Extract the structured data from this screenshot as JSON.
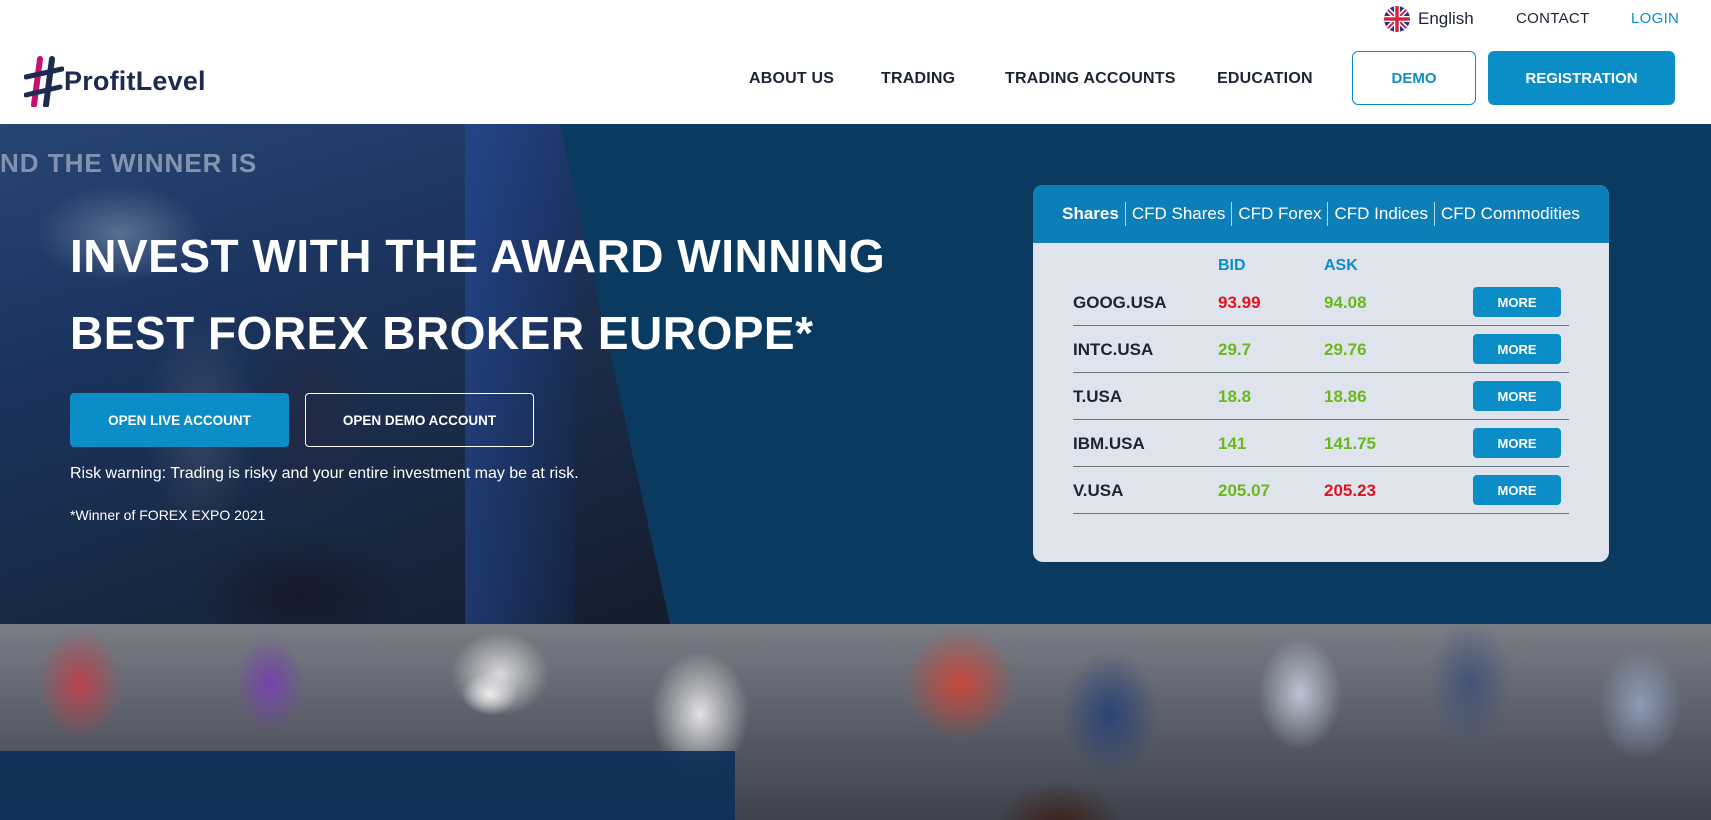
{
  "topbar": {
    "language": "English",
    "contact": "CONTACT",
    "login": "LOGIN"
  },
  "header": {
    "logo_text": "ProfitLevel",
    "nav": {
      "about": "ABOUT US",
      "trading": "TRADING",
      "accounts": "TRADING ACCOUNTS",
      "education": "EDUCATION"
    },
    "demo_button": "DEMO",
    "registration_button": "REGISTRATION"
  },
  "hero": {
    "background_text": "ND THE WINNER IS",
    "title_line1": "INVEST WITH THE AWARD WINNING",
    "title_line2": "BEST FOREX BROKER EUROPE*",
    "live_account_button": "OPEN LIVE ACCOUNT",
    "demo_account_button": "OPEN DEMO ACCOUNT",
    "risk_warning": "Risk warning: Trading is risky and your entire investment may be at risk.",
    "winner_note": "*Winner of FOREX EXPO 2021"
  },
  "quotes": {
    "tabs": [
      "Shares",
      "CFD Shares",
      "CFD Forex",
      "CFD Indices",
      "CFD Commodities"
    ],
    "active_tab": "Shares",
    "headers": {
      "bid": "BID",
      "ask": "ASK"
    },
    "more_label": "MORE",
    "rows": [
      {
        "symbol": "GOOG.USA",
        "bid": "93.99",
        "ask": "94.08",
        "bid_color": "#e0141e",
        "ask_color": "#6bb81e"
      },
      {
        "symbol": "INTC.USA",
        "bid": "29.7",
        "ask": "29.76",
        "bid_color": "#6bb81e",
        "ask_color": "#6bb81e"
      },
      {
        "symbol": "T.USA",
        "bid": "18.8",
        "ask": "18.86",
        "bid_color": "#6bb81e",
        "ask_color": "#6bb81e"
      },
      {
        "symbol": "IBM.USA",
        "bid": "141",
        "ask": "141.75",
        "bid_color": "#6bb81e",
        "ask_color": "#6bb81e"
      },
      {
        "symbol": "V.USA",
        "bid": "205.07",
        "ask": "205.23",
        "bid_color": "#6bb81e",
        "ask_color": "#e0141e"
      }
    ]
  },
  "colors": {
    "accent": "#0b8ec8",
    "hero_bg": "#0b3a60",
    "logo_navy": "#1d2b4f",
    "logo_magenta": "#c4126e",
    "price_up": "#6bb81e",
    "price_down": "#e0141e"
  },
  "icons": {
    "language_flag": "uk-flag-icon",
    "logo_mark": "hash-logo-icon"
  }
}
